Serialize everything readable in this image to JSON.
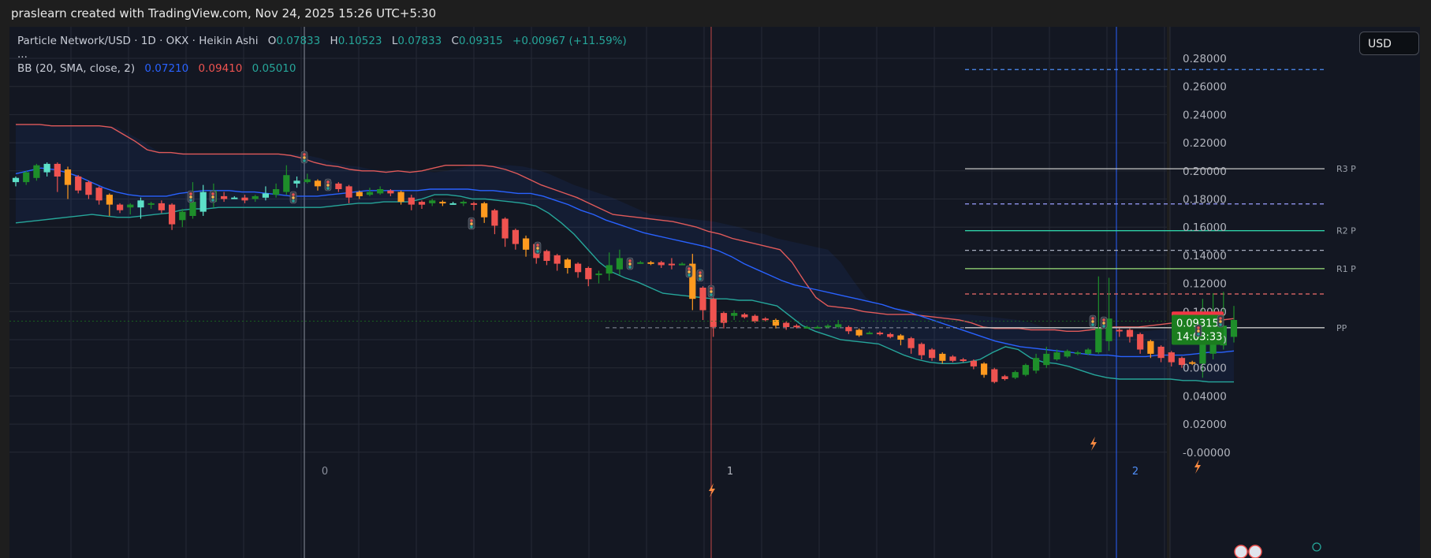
{
  "header": {
    "credit": "praslearn created with TradingView.com, Nov 24, 2025 15:26 UTC+5:30"
  },
  "legend": {
    "symbol": "Particle Network/USD · 1D · OKX · Heikin Ashi",
    "o_label": "O",
    "o": "0.07833",
    "h_label": "H",
    "h": "0.10523",
    "l_label": "L",
    "l": "0.07833",
    "c_label": "C",
    "c": "0.09315",
    "change": "+0.00967 (+11.59%)",
    "more": "...",
    "bb_label": "BB (20, SMA, close, 2)",
    "bb_basis": "0.07210",
    "bb_upper": "0.09410",
    "bb_lower": "0.05010"
  },
  "currency_button": "USD",
  "colors": {
    "bg": "#131722",
    "grid": "#262a35",
    "bull": "#1e8e2a",
    "bear": "#ef5350",
    "bull_ha_light": "#5ce0c8",
    "bear_ha_orange": "#ff9a1f",
    "bb_upper": "#e05a5a",
    "bb_basis": "#2962ff",
    "bb_lower": "#26a69a",
    "text": "#b2b5be"
  },
  "chart_data": {
    "type": "candlestick",
    "style": "Heikin Ashi",
    "ylim": [
      -0.01,
      0.3
    ],
    "yticks": [
      "0.28000",
      "0.26000",
      "0.24000",
      "0.22000",
      "0.20000",
      "0.18000",
      "0.16000",
      "0.14000",
      "0.12000",
      "0.10000",
      "0.08000",
      "0.06000",
      "0.04000",
      "0.02000",
      "-0.00000"
    ],
    "price_tags": [
      {
        "value": 0.09443,
        "text": "0.09443",
        "color": "#f23645"
      },
      {
        "value": 0.09315,
        "text": "0.09315",
        "sub": "14:03:33",
        "color": "#1b7d1f"
      }
    ],
    "pivot_levels": [
      {
        "value": 0.272,
        "label": "",
        "color": "#4f8ef7",
        "dash": true
      },
      {
        "value": 0.2015,
        "label": "R3 P",
        "color": "#c8c8c8",
        "dash": false
      },
      {
        "value": 0.1765,
        "label": "",
        "color": "#9aa0ff",
        "dash": true
      },
      {
        "value": 0.1575,
        "label": "R2 P",
        "color": "#2fd1a8",
        "dash": false
      },
      {
        "value": 0.1435,
        "label": "",
        "color": "#aab0c0",
        "dash": true
      },
      {
        "value": 0.1305,
        "label": "R1 P",
        "color": "#9be07a",
        "dash": false
      },
      {
        "value": 0.1125,
        "label": "",
        "color": "#f06b6b",
        "dash": true
      },
      {
        "value": 0.0885,
        "label": "PP",
        "color": "#c8c8c8",
        "dash": false
      }
    ],
    "session_labels": [
      "0",
      "1",
      "2"
    ],
    "bb_upper": [
      0.233,
      0.233,
      0.233,
      0.232,
      0.232,
      0.232,
      0.232,
      0.232,
      0.231,
      0.226,
      0.221,
      0.215,
      0.213,
      0.213,
      0.212,
      0.212,
      0.212,
      0.212,
      0.212,
      0.212,
      0.212,
      0.212,
      0.212,
      0.211,
      0.209,
      0.206,
      0.204,
      0.203,
      0.201,
      0.2,
      0.2,
      0.199,
      0.2,
      0.199,
      0.2,
      0.202,
      0.204,
      0.204,
      0.204,
      0.204,
      0.203,
      0.201,
      0.198,
      0.194,
      0.19,
      0.187,
      0.184,
      0.181,
      0.177,
      0.173,
      0.169,
      0.168,
      0.167,
      0.166,
      0.165,
      0.164,
      0.162,
      0.16,
      0.157,
      0.155,
      0.152,
      0.15,
      0.148,
      0.146,
      0.144,
      0.135,
      0.122,
      0.11,
      0.104,
      0.103,
      0.102,
      0.1,
      0.099,
      0.098,
      0.098,
      0.098,
      0.097,
      0.096,
      0.095,
      0.094,
      0.092,
      0.089,
      0.088,
      0.088,
      0.088,
      0.087,
      0.087,
      0.087,
      0.086,
      0.086,
      0.087,
      0.088,
      0.089,
      0.089,
      0.089,
      0.09,
      0.091,
      0.092,
      0.093,
      0.094,
      0.094,
      0.094,
      0.095
    ],
    "bb_basis": [
      0.198,
      0.2,
      0.202,
      0.201,
      0.199,
      0.196,
      0.192,
      0.188,
      0.185,
      0.183,
      0.182,
      0.182,
      0.182,
      0.184,
      0.185,
      0.186,
      0.186,
      0.186,
      0.185,
      0.185,
      0.184,
      0.183,
      0.182,
      0.182,
      0.182,
      0.183,
      0.184,
      0.185,
      0.186,
      0.186,
      0.186,
      0.186,
      0.186,
      0.187,
      0.187,
      0.187,
      0.187,
      0.186,
      0.186,
      0.185,
      0.184,
      0.184,
      0.182,
      0.179,
      0.176,
      0.172,
      0.169,
      0.165,
      0.162,
      0.159,
      0.156,
      0.154,
      0.152,
      0.15,
      0.148,
      0.146,
      0.143,
      0.139,
      0.134,
      0.13,
      0.126,
      0.122,
      0.119,
      0.117,
      0.115,
      0.113,
      0.111,
      0.109,
      0.107,
      0.105,
      0.102,
      0.1,
      0.097,
      0.094,
      0.091,
      0.088,
      0.085,
      0.082,
      0.079,
      0.077,
      0.075,
      0.074,
      0.073,
      0.072,
      0.071,
      0.07,
      0.069,
      0.069,
      0.068,
      0.068,
      0.068,
      0.069,
      0.069,
      0.069,
      0.07,
      0.071,
      0.071,
      0.072
    ],
    "bb_lower": [
      0.163,
      0.164,
      0.165,
      0.166,
      0.167,
      0.168,
      0.169,
      0.168,
      0.167,
      0.167,
      0.168,
      0.169,
      0.17,
      0.172,
      0.173,
      0.173,
      0.174,
      0.174,
      0.174,
      0.174,
      0.174,
      0.174,
      0.174,
      0.174,
      0.174,
      0.175,
      0.176,
      0.177,
      0.177,
      0.178,
      0.178,
      0.178,
      0.18,
      0.183,
      0.183,
      0.182,
      0.18,
      0.18,
      0.179,
      0.178,
      0.177,
      0.175,
      0.17,
      0.163,
      0.155,
      0.145,
      0.135,
      0.128,
      0.124,
      0.121,
      0.117,
      0.113,
      0.112,
      0.111,
      0.11,
      0.109,
      0.109,
      0.108,
      0.108,
      0.106,
      0.104,
      0.097,
      0.09,
      0.086,
      0.083,
      0.08,
      0.079,
      0.078,
      0.077,
      0.073,
      0.069,
      0.066,
      0.064,
      0.063,
      0.063,
      0.064,
      0.066,
      0.071,
      0.075,
      0.073,
      0.067,
      0.064,
      0.063,
      0.061,
      0.058,
      0.055,
      0.053,
      0.052,
      0.052,
      0.052,
      0.052,
      0.052,
      0.051,
      0.051,
      0.05,
      0.05,
      0.05
    ],
    "candles": [
      [
        0.192,
        0.195,
        0.189,
        0.196
      ],
      [
        0.192,
        0.199,
        0.19,
        0.2
      ],
      [
        0.195,
        0.204,
        0.193,
        0.205
      ],
      [
        0.199,
        0.205,
        0.196,
        0.206
      ],
      [
        0.205,
        0.196,
        0.185,
        0.206
      ],
      [
        0.201,
        0.19,
        0.18,
        0.203
      ],
      [
        0.196,
        0.186,
        0.184,
        0.197
      ],
      [
        0.192,
        0.183,
        0.18,
        0.193
      ],
      [
        0.188,
        0.179,
        0.176,
        0.189
      ],
      [
        0.183,
        0.176,
        0.168,
        0.184
      ],
      [
        0.176,
        0.172,
        0.17,
        0.177
      ],
      [
        0.174,
        0.176,
        0.169,
        0.177
      ],
      [
        0.174,
        0.179,
        0.166,
        0.181
      ],
      [
        0.176,
        0.177,
        0.173,
        0.178
      ],
      [
        0.177,
        0.172,
        0.17,
        0.179
      ],
      [
        0.176,
        0.162,
        0.158,
        0.177
      ],
      [
        0.165,
        0.171,
        0.16,
        0.173
      ],
      [
        0.168,
        0.178,
        0.166,
        0.192
      ],
      [
        0.171,
        0.185,
        0.168,
        0.19
      ],
      [
        0.178,
        0.186,
        0.174,
        0.191
      ],
      [
        0.182,
        0.18,
        0.178,
        0.185
      ],
      [
        0.181,
        0.181,
        0.18,
        0.182
      ],
      [
        0.181,
        0.179,
        0.177,
        0.183
      ],
      [
        0.18,
        0.182,
        0.178,
        0.183
      ],
      [
        0.181,
        0.184,
        0.179,
        0.189
      ],
      [
        0.183,
        0.187,
        0.181,
        0.191
      ],
      [
        0.185,
        0.197,
        0.183,
        0.204
      ],
      [
        0.191,
        0.193,
        0.188,
        0.196
      ],
      [
        0.192,
        0.194,
        0.191,
        0.198
      ],
      [
        0.193,
        0.189,
        0.186,
        0.194
      ],
      [
        0.191,
        0.192,
        0.19,
        0.193
      ],
      [
        0.191,
        0.187,
        0.185,
        0.192
      ],
      [
        0.189,
        0.181,
        0.177,
        0.19
      ],
      [
        0.185,
        0.182,
        0.18,
        0.186
      ],
      [
        0.183,
        0.185,
        0.182,
        0.188
      ],
      [
        0.184,
        0.187,
        0.183,
        0.189
      ],
      [
        0.186,
        0.184,
        0.182,
        0.187
      ],
      [
        0.185,
        0.178,
        0.176,
        0.186
      ],
      [
        0.181,
        0.176,
        0.172,
        0.183
      ],
      [
        0.178,
        0.176,
        0.173,
        0.179
      ],
      [
        0.177,
        0.179,
        0.175,
        0.18
      ],
      [
        0.178,
        0.177,
        0.175,
        0.179
      ],
      [
        0.177,
        0.177,
        0.176,
        0.178
      ],
      [
        0.177,
        0.178,
        0.175,
        0.179
      ],
      [
        0.177,
        0.176,
        0.172,
        0.178
      ],
      [
        0.177,
        0.167,
        0.163,
        0.178
      ],
      [
        0.172,
        0.161,
        0.155,
        0.173
      ],
      [
        0.166,
        0.152,
        0.146,
        0.167
      ],
      [
        0.158,
        0.148,
        0.144,
        0.159
      ],
      [
        0.152,
        0.144,
        0.139,
        0.154
      ],
      [
        0.148,
        0.138,
        0.134,
        0.149
      ],
      [
        0.143,
        0.136,
        0.133,
        0.144
      ],
      [
        0.14,
        0.134,
        0.129,
        0.141
      ],
      [
        0.137,
        0.131,
        0.127,
        0.138
      ],
      [
        0.134,
        0.128,
        0.124,
        0.135
      ],
      [
        0.131,
        0.123,
        0.118,
        0.132
      ],
      [
        0.127,
        0.127,
        0.12,
        0.129
      ],
      [
        0.127,
        0.133,
        0.122,
        0.142
      ],
      [
        0.13,
        0.138,
        0.126,
        0.144
      ],
      [
        0.134,
        0.136,
        0.133,
        0.138
      ],
      [
        0.135,
        0.135,
        0.134,
        0.136
      ],
      [
        0.135,
        0.134,
        0.133,
        0.136
      ],
      [
        0.135,
        0.133,
        0.131,
        0.136
      ],
      [
        0.134,
        0.133,
        0.13,
        0.138
      ],
      [
        0.134,
        0.134,
        0.133,
        0.135
      ],
      [
        0.134,
        0.109,
        0.101,
        0.141
      ],
      [
        0.117,
        0.101,
        0.094,
        0.118
      ],
      [
        0.109,
        0.089,
        0.082,
        0.11
      ],
      [
        0.099,
        0.092,
        0.088,
        0.1
      ],
      [
        0.097,
        0.099,
        0.094,
        0.101
      ],
      [
        0.098,
        0.096,
        0.095,
        0.099
      ],
      [
        0.097,
        0.093,
        0.092,
        0.098
      ],
      [
        0.095,
        0.094,
        0.093,
        0.096
      ],
      [
        0.094,
        0.09,
        0.088,
        0.095
      ],
      [
        0.092,
        0.089,
        0.087,
        0.093
      ],
      [
        0.09,
        0.089,
        0.088,
        0.091
      ],
      [
        0.089,
        0.089,
        0.088,
        0.09
      ],
      [
        0.089,
        0.089,
        0.088,
        0.09
      ],
      [
        0.089,
        0.09,
        0.088,
        0.091
      ],
      [
        0.089,
        0.091,
        0.088,
        0.094
      ],
      [
        0.089,
        0.086,
        0.084,
        0.09
      ],
      [
        0.087,
        0.083,
        0.082,
        0.088
      ],
      [
        0.085,
        0.085,
        0.084,
        0.086
      ],
      [
        0.085,
        0.084,
        0.083,
        0.086
      ],
      [
        0.084,
        0.082,
        0.081,
        0.085
      ],
      [
        0.083,
        0.08,
        0.076,
        0.084
      ],
      [
        0.081,
        0.074,
        0.07,
        0.082
      ],
      [
        0.077,
        0.069,
        0.066,
        0.078
      ],
      [
        0.073,
        0.067,
        0.065,
        0.074
      ],
      [
        0.07,
        0.065,
        0.063,
        0.071
      ],
      [
        0.068,
        0.065,
        0.064,
        0.069
      ],
      [
        0.066,
        0.065,
        0.064,
        0.067
      ],
      [
        0.065,
        0.061,
        0.059,
        0.066
      ],
      [
        0.063,
        0.055,
        0.053,
        0.064
      ],
      [
        0.059,
        0.05,
        0.049,
        0.06
      ],
      [
        0.054,
        0.052,
        0.051,
        0.055
      ],
      [
        0.053,
        0.057,
        0.052,
        0.058
      ],
      [
        0.055,
        0.062,
        0.054,
        0.063
      ],
      [
        0.058,
        0.067,
        0.056,
        0.07
      ],
      [
        0.062,
        0.07,
        0.06,
        0.075
      ],
      [
        0.066,
        0.071,
        0.065,
        0.073
      ],
      [
        0.068,
        0.072,
        0.067,
        0.073
      ],
      [
        0.07,
        0.071,
        0.069,
        0.072
      ],
      [
        0.07,
        0.073,
        0.069,
        0.074
      ],
      [
        0.071,
        0.088,
        0.07,
        0.125
      ],
      [
        0.079,
        0.095,
        0.072,
        0.124
      ],
      [
        0.087,
        0.086,
        0.082,
        0.088
      ],
      [
        0.087,
        0.082,
        0.078,
        0.088
      ],
      [
        0.084,
        0.073,
        0.07,
        0.085
      ],
      [
        0.079,
        0.07,
        0.067,
        0.08
      ],
      [
        0.075,
        0.067,
        0.064,
        0.076
      ],
      [
        0.071,
        0.064,
        0.061,
        0.072
      ],
      [
        0.067,
        0.062,
        0.06,
        0.068
      ],
      [
        0.064,
        0.063,
        0.062,
        0.065
      ],
      [
        0.063,
        0.078,
        0.053,
        0.109
      ],
      [
        0.07,
        0.083,
        0.066,
        0.113
      ],
      [
        0.076,
        0.09,
        0.073,
        0.114
      ],
      [
        0.082,
        0.094,
        0.078,
        0.104
      ]
    ]
  }
}
